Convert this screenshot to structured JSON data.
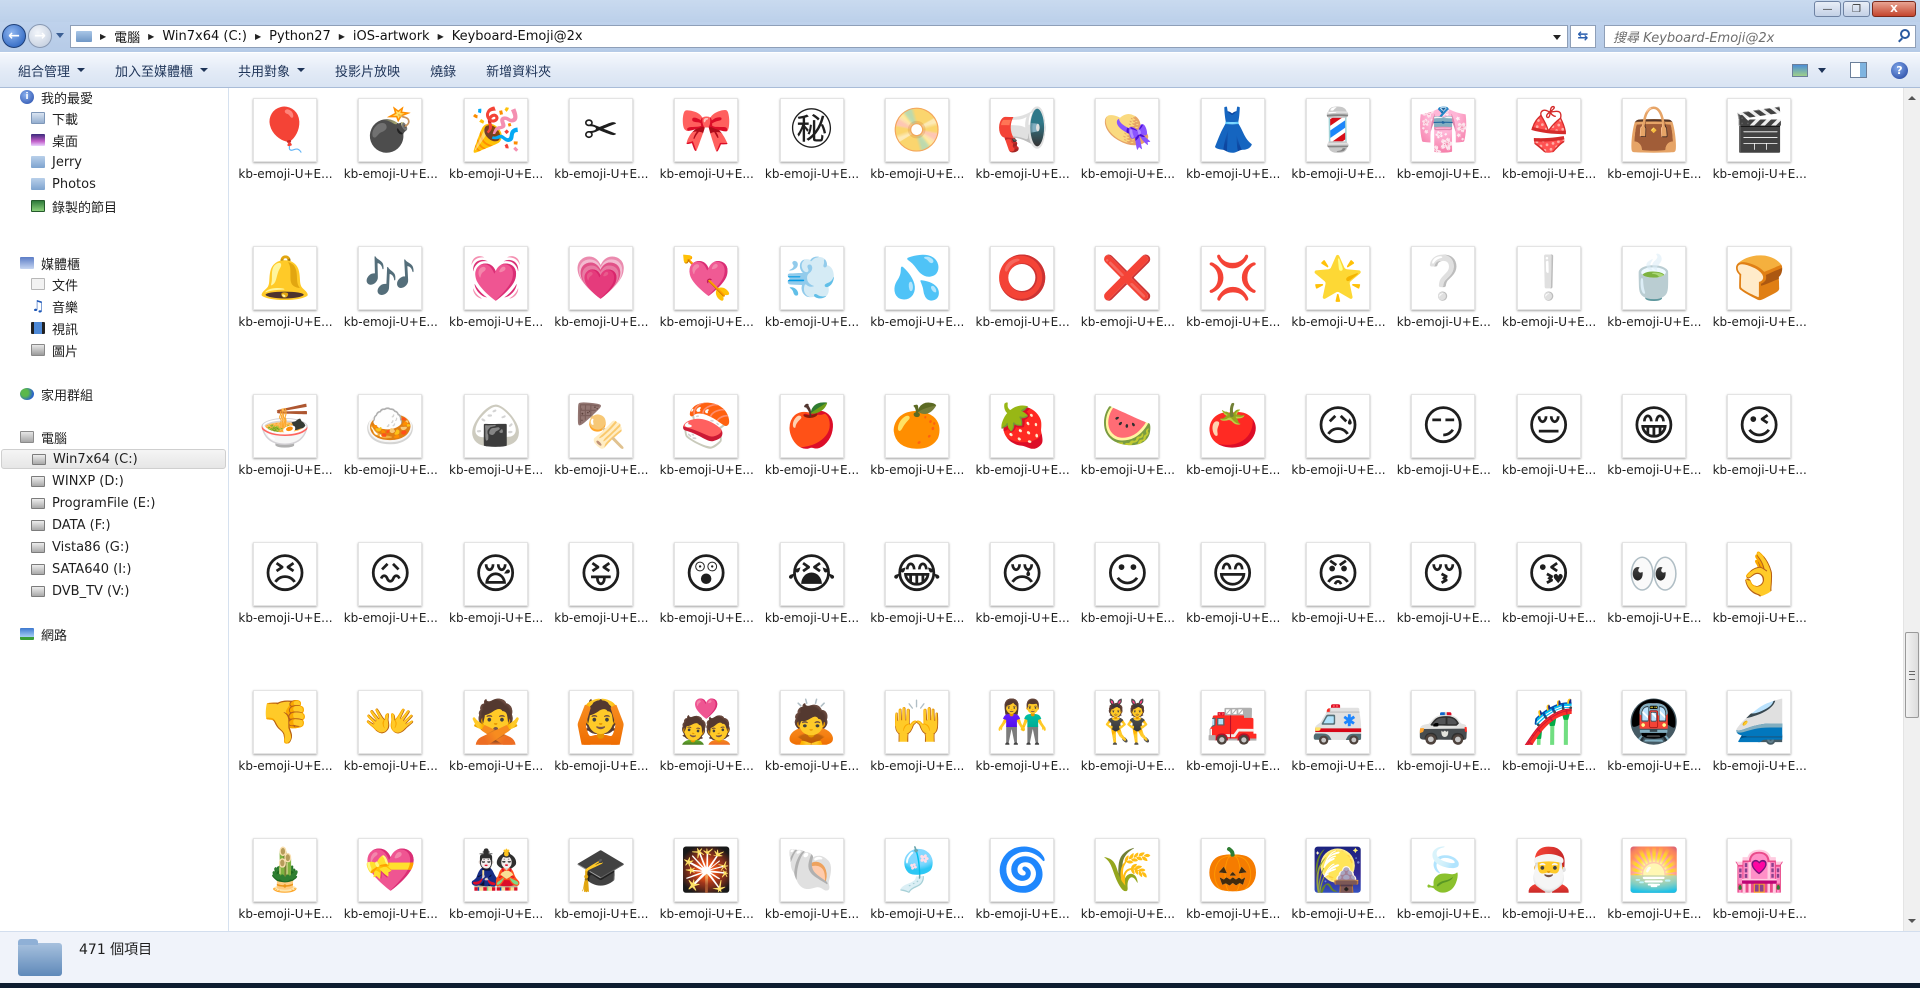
{
  "window": {
    "buttons": {
      "minimize": "—",
      "maximize": "❐",
      "close": "X"
    }
  },
  "address": {
    "breadcrumbs": [
      "電腦",
      "Win7x64 (C:)",
      "Python27",
      "iOS-artwork",
      "Keyboard-Emoji@2x"
    ],
    "search_placeholder": "搜尋 Keyboard-Emoji@2x"
  },
  "toolbar": {
    "items": [
      {
        "label": "組合管理",
        "dropdown": true
      },
      {
        "label": "加入至媒體櫃",
        "dropdown": true
      },
      {
        "label": "共用對象",
        "dropdown": true
      },
      {
        "label": "投影片放映",
        "dropdown": false
      },
      {
        "label": "燒錄",
        "dropdown": false
      },
      {
        "label": "新增資料夾",
        "dropdown": false
      }
    ],
    "help_label": "?"
  },
  "sidebar": {
    "favorites": {
      "label": "我的最愛",
      "items": [
        "下載",
        "桌面",
        "Jerry",
        "Photos",
        "錄製的節目"
      ]
    },
    "libraries": {
      "label": "媒體櫃",
      "items": [
        "文件",
        "音樂",
        "視訊",
        "圖片"
      ]
    },
    "homegroup": {
      "label": "家用群組"
    },
    "computer": {
      "label": "電腦",
      "items": [
        "Win7x64 (C:)",
        "WINXP (D:)",
        "ProgramFile (E:)",
        "DATA (F:)",
        "Vista86 (G:)",
        "SATA640 (I:)",
        "DVB_TV (V:)"
      ],
      "selected": "Win7x64 (C:)"
    },
    "network": {
      "label": "網路"
    }
  },
  "files": {
    "label_truncated": "kb-emoji-U+E...",
    "rows": [
      [
        "🎈",
        "💣",
        "🎉",
        "✂",
        "🎀",
        "㊙",
        "📀",
        "📢",
        "👒",
        "👗",
        "💈",
        "👘",
        "👙",
        "👜",
        "🎬"
      ],
      [
        "🔔",
        "🎶",
        "💓",
        "💗",
        "💘",
        "💨",
        "💦",
        "⭕",
        "❌",
        "💢",
        "🌟",
        "❔",
        "❕",
        "🍵",
        "🍞"
      ],
      [
        "🍜",
        "🍛",
        "🍙",
        "🍢",
        "🍣",
        "🍎",
        "🍊",
        "🍓",
        "🍉",
        "🍅",
        "😥",
        "😏",
        "😔",
        "😁",
        "😉"
      ],
      [
        "😣",
        "😖",
        "😪",
        "😝",
        "😲",
        "😭",
        "😂",
        "😢",
        "☺",
        "😄",
        "😡",
        "😚",
        "😘",
        "👀",
        "👌"
      ],
      [
        "👎",
        "👐",
        "🙅",
        "🙆",
        "💑",
        "🙇",
        "🙌",
        "👫",
        "👯",
        "🚒",
        "🚑",
        "🚓",
        "🎢",
        "🚇",
        "🚄"
      ],
      [
        "🎍",
        "💝",
        "🎎",
        "🎓",
        "🎇",
        "🐚",
        "🎐",
        "🌀",
        "🌾",
        "🎃",
        "🎑",
        "🍃",
        "🎅",
        "🌅",
        "🏩"
      ]
    ]
  },
  "scrollbar": {
    "position_fraction": 0.73
  },
  "status": {
    "item_count": "471 個項目"
  }
}
